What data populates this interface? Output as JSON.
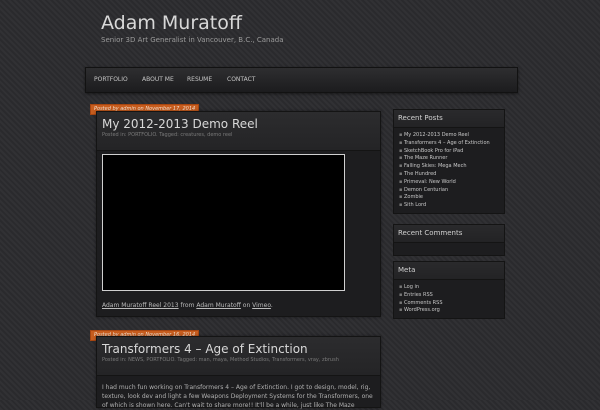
{
  "site": {
    "title": "Adam Muratoff",
    "tagline": "Senior 3D Art Generalist in Vancouver, B.C., Canada"
  },
  "nav": [
    "PORTFOLIO",
    "ABOUT ME",
    "RESUME",
    "CONTACT"
  ],
  "posts": [
    {
      "date_prefix": "Posted by",
      "author": "admin",
      "date_on": "on",
      "date": "November 17, 2014",
      "title": "My 2012-2013 Demo Reel",
      "meta": "Posted in: PORTFOLIO. Tagged: creatures, demo reel",
      "caption": {
        "link1": "Adam Muratoff Reel 2013",
        "from": " from ",
        "link2": "Adam Muratoff",
        "on": " on ",
        "link3": "Vimeo",
        "end": "."
      }
    },
    {
      "date_prefix": "Posted by",
      "author": "admin",
      "date_on": "on",
      "date": "November 16, 2014",
      "title": "Transformers 4 – Age of Extinction",
      "meta": "Posted in: NEWS, PORTFOLIO. Tagged: man, maya, Method Studios, Transformers, vray, zbrush",
      "body": "I had much fun working on Transformers 4 – Age of Extinction. I got to design, model, rig, texture, look dev and light a few Weapons Deployment Systems for the Transformers, one of which is shown here. Can't wait to share more!! It'll be a while, just like The Maze"
    }
  ],
  "widgets": {
    "recent_posts": {
      "title": "Recent Posts",
      "items": [
        "My 2012-2013 Demo Reel",
        "Transformers 4 – Age of Extinction",
        "SketchBook Pro for iPad",
        "The Maze Runner",
        "Falling Skies: Mega Mech",
        "The Hundred",
        "Primeval: New World",
        "Demon Centurian",
        "Zombie",
        "Sith Lord"
      ]
    },
    "recent_comments": {
      "title": "Recent Comments"
    },
    "meta": {
      "title": "Meta",
      "items": [
        "Log in",
        "Entries RSS",
        "Comments RSS",
        "WordPress.org"
      ]
    }
  }
}
